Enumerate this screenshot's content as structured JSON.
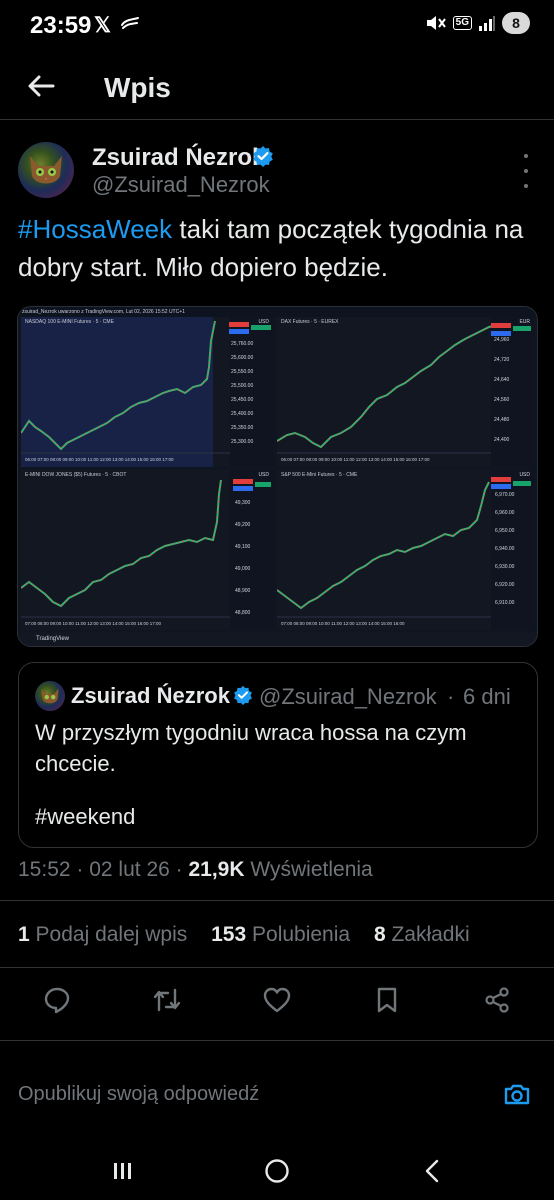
{
  "status_bar": {
    "time": "23:59",
    "x_label": "𝕏",
    "network": "5G",
    "battery": "8"
  },
  "header": {
    "title": "Wpis"
  },
  "tweet": {
    "author_name": "Zsuirad Ńezrok",
    "author_handle": "@Zsuirad_Nezrok",
    "text_hashtag": "#HossaWeek",
    "text_body": " taki tam początek tygodnia na dobry start. Miło dopiero będzie."
  },
  "chart_image": {
    "header_text": "zsuirad_Nezrok uwarzono z TradingView.com, Lut 02, 2026 15:52 UTC+1",
    "footer_text": "TradingView",
    "currency_usd": "USD",
    "currency_eur": "EUR",
    "panels": [
      {
        "title": "NASDAQ 100 E-MINI Futures · 5 · CME"
      },
      {
        "title": "DAX Futures · 5 · EUREX"
      },
      {
        "title": "E-MINI DOW JONES ($5) Futures · 5 · CBOT"
      },
      {
        "title": "S&P 500 E-Mini Futures · 5 · CME"
      }
    ]
  },
  "quote": {
    "author_name": "Zsuirad Ńezrok",
    "author_handle": "@Zsuirad_Nezrok",
    "dot": "·",
    "time_ago": "6 dni",
    "text": "W przyszłym tygodniu wraca hossa na czym chcecie.",
    "hashtag": "#weekend"
  },
  "meta": {
    "time": "15:52",
    "sep1": " · ",
    "date": "02 lut 26",
    "sep2": " · ",
    "views_count": "21,9K",
    "views_label": " Wyświetlenia"
  },
  "stats": {
    "reposts_count": "1",
    "reposts_label": " Podaj dalej wpis",
    "likes_count": "153",
    "likes_label": " Polubienia",
    "bookmarks_count": "8",
    "bookmarks_label": " Zakładki"
  },
  "reply": {
    "placeholder": "Opublikuj swoją odpowiedź"
  },
  "icons": {
    "back": "arrow-left-icon",
    "verified": "verified-badge-icon",
    "more": "more-vertical-icon",
    "reply": "reply-icon",
    "repost": "repost-icon",
    "like": "heart-icon",
    "bookmark": "bookmark-icon",
    "share": "share-icon",
    "camera": "camera-icon",
    "nav_recent": "recent-apps-icon",
    "nav_home": "home-icon",
    "nav_back": "back-icon"
  },
  "colors": {
    "background": "#000000",
    "text": "#e7e9ea",
    "muted": "#71767b",
    "accent": "#1d9bf0",
    "divider": "#2f3336"
  }
}
